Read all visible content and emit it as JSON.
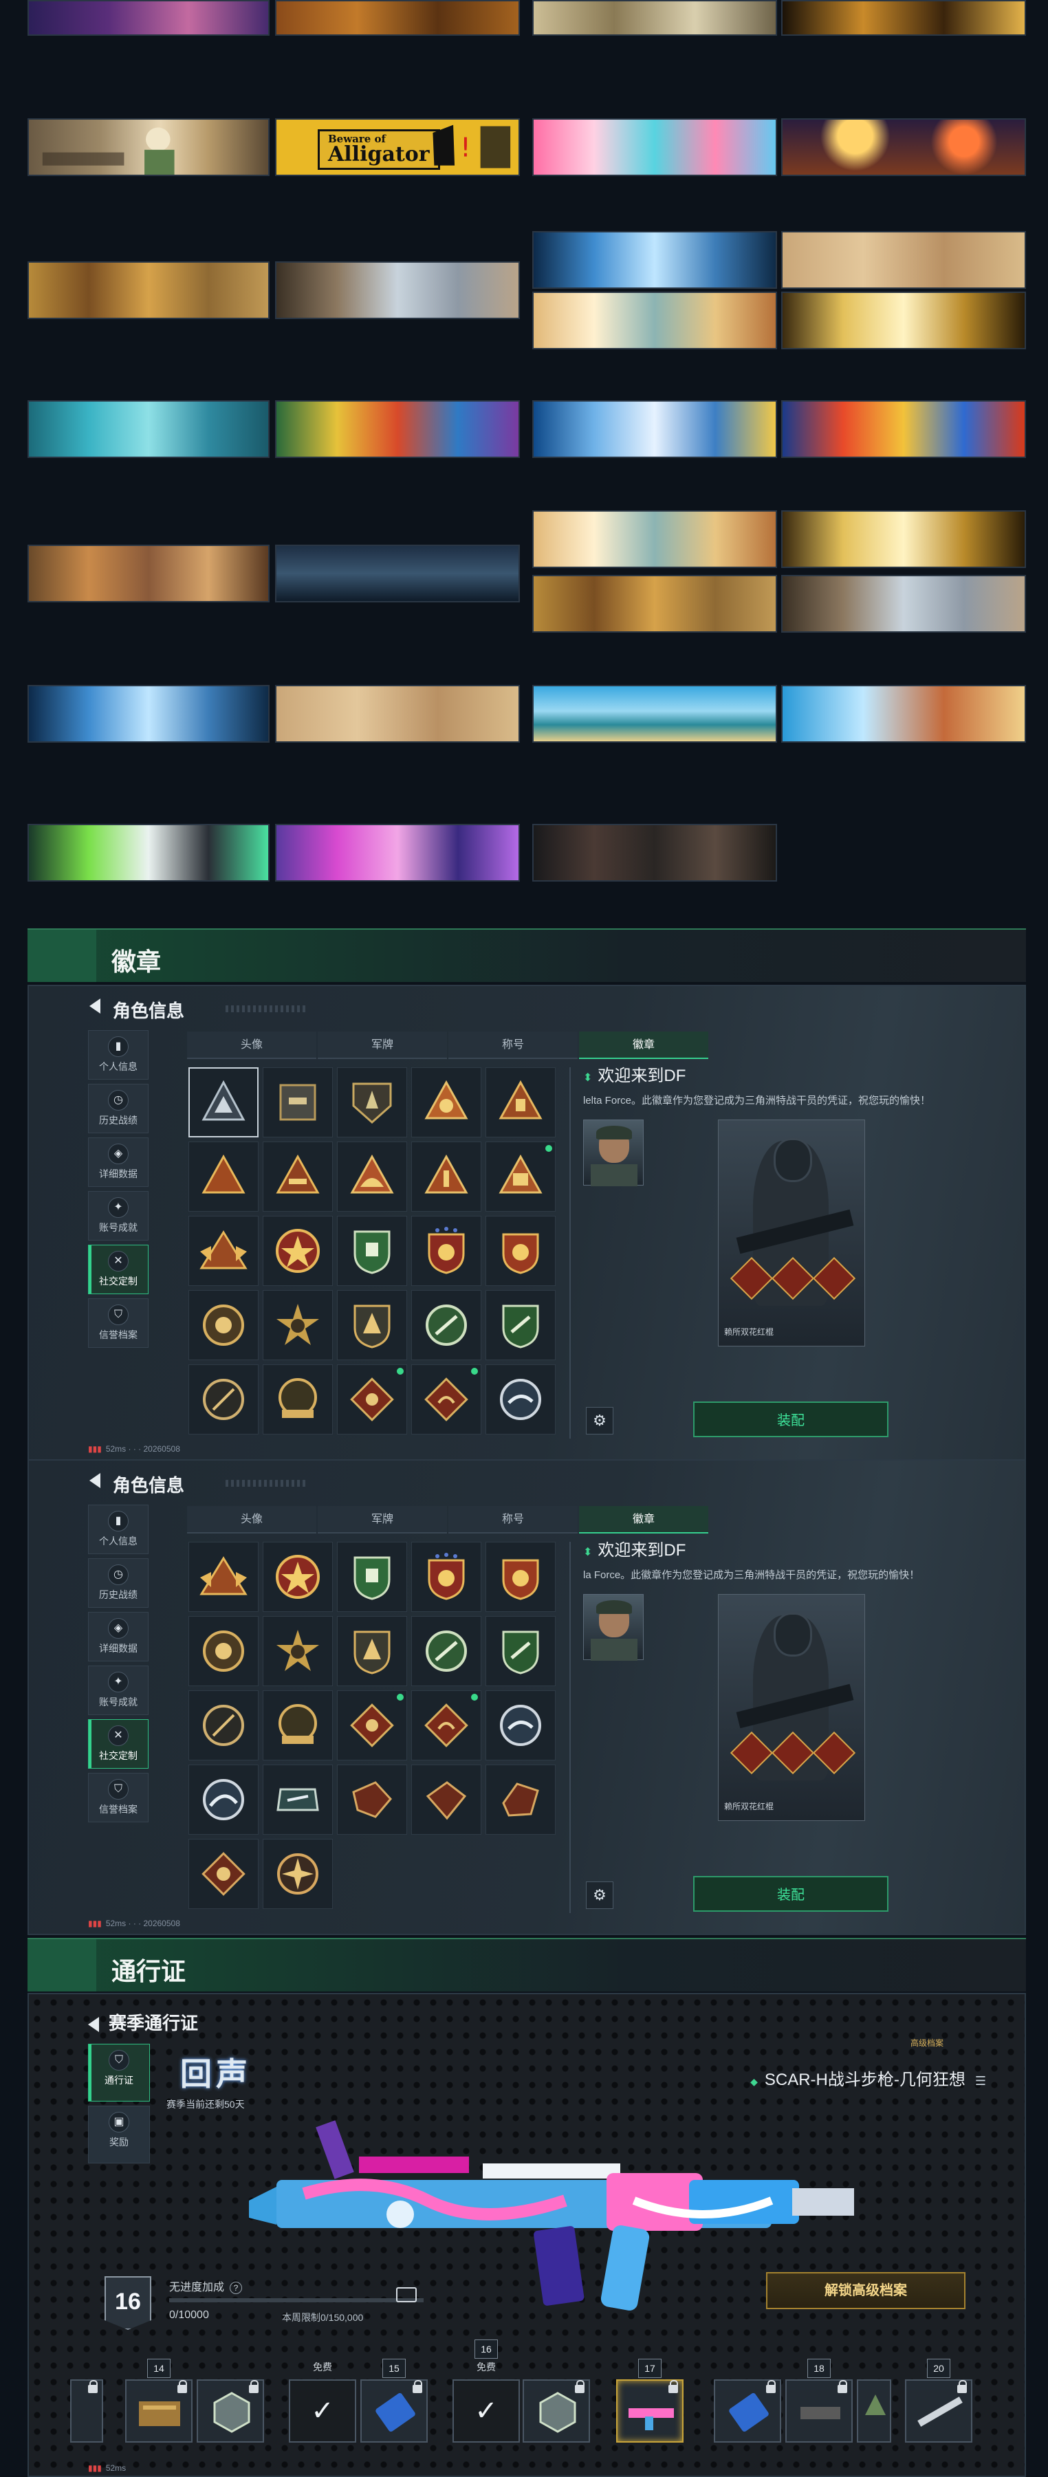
{
  "gallery": {
    "banner1_label": "Beware of",
    "banner2_label": "Alligator"
  },
  "sections": {
    "badges": "徽章",
    "pass": "通行证"
  },
  "badge_panel": {
    "title": "角色信息",
    "sidenav": [
      {
        "label": "个人信息",
        "icon": "bar-chart-icon"
      },
      {
        "label": "历史战绩",
        "icon": "history-icon"
      },
      {
        "label": "详细数据",
        "icon": "data-icon"
      },
      {
        "label": "账号成就",
        "icon": "trophy-icon"
      },
      {
        "label": "社交定制",
        "icon": "tools-icon"
      },
      {
        "label": "信誉档案",
        "icon": "shield-icon"
      }
    ],
    "tabs": [
      "头像",
      "军牌",
      "称号",
      "徽章"
    ],
    "active_tab": "徽章",
    "detail_title": "欢迎来到DF",
    "detail_desc": "lelta Force。此徽章作为您登记成为三角洲特战干员的凭证，祝您玩的愉快！",
    "detail_desc_2": "la Force。此徽章作为您登记成为三角洲特战干员的凭证，祝您玩的愉快！",
    "card_name": "赖所双花红棍",
    "equip": "装配",
    "status": "52ms",
    "status_id": "20260508"
  },
  "pass": {
    "header": "赛季通行证",
    "nav": [
      {
        "label": "通行证",
        "icon": "pass-icon"
      },
      {
        "label": "奖励",
        "icon": "gift-icon"
      }
    ],
    "logo": "回声",
    "season_remaining": "赛季当前还剩50天",
    "tier_tag": "高级档案",
    "weapon": "SCAR-H战斗步枪-几何狂想",
    "level": "16",
    "xp_label": "无进度加成",
    "xp_value": "0/10000",
    "xp_week": "本周限制0/150,000",
    "unlock": "解锁高级档案",
    "free_label": "免费",
    "reward_levels": [
      "14",
      "15",
      "16",
      "17",
      "18",
      "20"
    ],
    "status": "52ms",
    "progress": 0
  },
  "colors": {
    "accent": "#35d08f",
    "gold": "#c9a53a",
    "panel": "#222c35"
  }
}
